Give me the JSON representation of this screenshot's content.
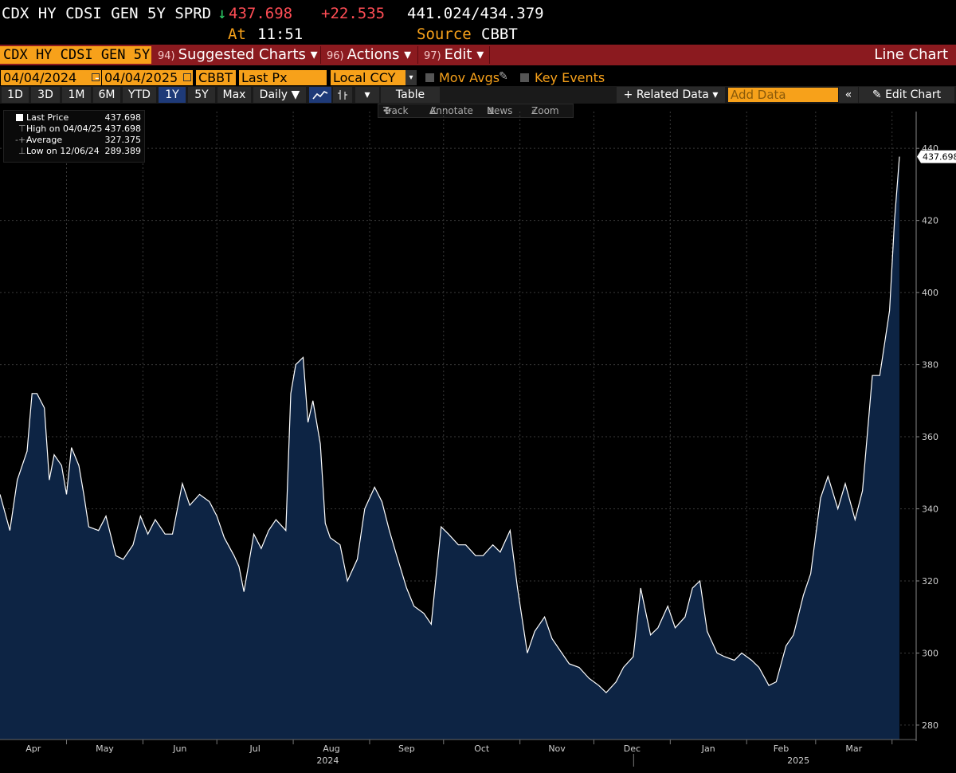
{
  "header": {
    "ticker": "CDX HY CDSI GEN 5Y SPRD",
    "arrow": "↓",
    "last": "437.698",
    "change": "+22.535",
    "bid_ask": "441.024/434.379",
    "time_label": "At",
    "time": "11:51",
    "source_label": "Source",
    "source": "CBBT"
  },
  "menubar": {
    "ticker_field": "CDX HY CDSI GEN 5Y",
    "items": [
      {
        "num": "94)",
        "label": "Suggested Charts ▾"
      },
      {
        "num": "96)",
        "label": "Actions ▾"
      },
      {
        "num": "97)",
        "label": "Edit ▾"
      }
    ],
    "chart_type": "Line Chart"
  },
  "controls": {
    "start_date": "04/04/2024",
    "dash": "-",
    "end_date": "04/04/2025",
    "source": "CBBT",
    "field": "Last Px",
    "currency": "Local CCY",
    "mov_avgs": "Mov Avgs",
    "key_events": "Key Events"
  },
  "toolbar": {
    "periods": [
      "1D",
      "3D",
      "1M",
      "6M",
      "YTD",
      "1Y",
      "5Y",
      "Max"
    ],
    "active_period": "1Y",
    "frequency": "Daily ▼",
    "table": "Table",
    "related": "+ Related Data ▾",
    "add_data_placeholder": "Add Data",
    "collapse": "«",
    "edit_chart": "✎ Edit Chart"
  },
  "tools": {
    "track": "Track",
    "annotate": "Annotate",
    "news": "News",
    "zoom": "Zoom"
  },
  "legend": {
    "last_label": "Last Price",
    "last_value": "437.698",
    "high_label": "High on 04/04/25",
    "high_value": "437.698",
    "avg_label": "Average",
    "avg_value": "327.375",
    "low_label": "Low on 12/06/24",
    "low_value": "289.389"
  },
  "chart_data": {
    "type": "area",
    "series": [
      {
        "name": "Last Price"
      }
    ],
    "last_label": "437.698",
    "ylim": [
      276,
      448
    ],
    "y_ticks": [
      280,
      300,
      320,
      340,
      360,
      380,
      400,
      420,
      440
    ],
    "x_months": [
      "Apr",
      "May",
      "Jun",
      "Jul",
      "Aug",
      "Sep",
      "Oct",
      "Nov",
      "Dec",
      "Jan",
      "Feb",
      "Mar"
    ],
    "x_year_labels": [
      "2024",
      "2025"
    ],
    "grid": true,
    "colors": {
      "line": "#ffffff",
      "fill": "#0d2444",
      "grid": "#3a3a3a",
      "axis_text": "#cfcfcf",
      "last_badge": "#ffffff"
    },
    "points": [
      [
        "2024-04-04",
        344
      ],
      [
        "2024-04-08",
        334
      ],
      [
        "2024-04-11",
        348
      ],
      [
        "2024-04-15",
        356
      ],
      [
        "2024-04-17",
        372
      ],
      [
        "2024-04-19",
        372
      ],
      [
        "2024-04-22",
        368
      ],
      [
        "2024-04-24",
        348
      ],
      [
        "2024-04-26",
        355
      ],
      [
        "2024-04-29",
        352
      ],
      [
        "2024-05-01",
        344
      ],
      [
        "2024-05-03",
        357
      ],
      [
        "2024-05-06",
        352
      ],
      [
        "2024-05-08",
        344
      ],
      [
        "2024-05-10",
        335
      ],
      [
        "2024-05-14",
        334
      ],
      [
        "2024-05-17",
        338
      ],
      [
        "2024-05-21",
        327
      ],
      [
        "2024-05-24",
        326
      ],
      [
        "2024-05-28",
        330
      ],
      [
        "2024-05-31",
        338
      ],
      [
        "2024-06-03",
        333
      ],
      [
        "2024-06-06",
        337
      ],
      [
        "2024-06-10",
        333
      ],
      [
        "2024-06-13",
        333
      ],
      [
        "2024-06-17",
        347
      ],
      [
        "2024-06-20",
        341
      ],
      [
        "2024-06-24",
        344
      ],
      [
        "2024-06-28",
        342
      ],
      [
        "2024-07-01",
        338
      ],
      [
        "2024-07-04",
        332
      ],
      [
        "2024-07-08",
        327
      ],
      [
        "2024-07-10",
        324
      ],
      [
        "2024-07-12",
        317
      ],
      [
        "2024-07-16",
        333
      ],
      [
        "2024-07-19",
        329
      ],
      [
        "2024-07-22",
        334
      ],
      [
        "2024-07-25",
        337
      ],
      [
        "2024-07-29",
        334
      ],
      [
        "2024-07-31",
        372
      ],
      [
        "2024-08-02",
        380
      ],
      [
        "2024-08-05",
        382
      ],
      [
        "2024-08-07",
        364
      ],
      [
        "2024-08-09",
        370
      ],
      [
        "2024-08-12",
        358
      ],
      [
        "2024-08-14",
        336
      ],
      [
        "2024-08-16",
        332
      ],
      [
        "2024-08-20",
        330
      ],
      [
        "2024-08-23",
        320
      ],
      [
        "2024-08-27",
        326
      ],
      [
        "2024-08-30",
        340
      ],
      [
        "2024-09-03",
        346
      ],
      [
        "2024-09-06",
        342
      ],
      [
        "2024-09-09",
        334
      ],
      [
        "2024-09-12",
        327
      ],
      [
        "2024-09-16",
        318
      ],
      [
        "2024-09-19",
        313
      ],
      [
        "2024-09-23",
        311
      ],
      [
        "2024-09-26",
        308
      ],
      [
        "2024-09-30",
        335
      ],
      [
        "2024-10-03",
        333
      ],
      [
        "2024-10-07",
        330
      ],
      [
        "2024-10-10",
        330
      ],
      [
        "2024-10-14",
        327
      ],
      [
        "2024-10-17",
        327
      ],
      [
        "2024-10-21",
        330
      ],
      [
        "2024-10-24",
        328
      ],
      [
        "2024-10-28",
        334
      ],
      [
        "2024-10-31",
        318
      ],
      [
        "2024-11-04",
        300
      ],
      [
        "2024-11-07",
        306
      ],
      [
        "2024-11-11",
        310
      ],
      [
        "2024-11-14",
        304
      ],
      [
        "2024-11-18",
        300
      ],
      [
        "2024-11-21",
        297
      ],
      [
        "2024-11-25",
        296
      ],
      [
        "2024-11-29",
        293
      ],
      [
        "2024-12-03",
        291
      ],
      [
        "2024-12-06",
        289
      ],
      [
        "2024-12-10",
        292
      ],
      [
        "2024-12-13",
        296
      ],
      [
        "2024-12-17",
        299
      ],
      [
        "2024-12-20",
        318
      ],
      [
        "2024-12-24",
        305
      ],
      [
        "2024-12-27",
        307
      ],
      [
        "2024-12-31",
        313
      ],
      [
        "2025-01-03",
        307
      ],
      [
        "2025-01-07",
        310
      ],
      [
        "2025-01-10",
        318
      ],
      [
        "2025-01-13",
        320
      ],
      [
        "2025-01-16",
        306
      ],
      [
        "2025-01-20",
        300
      ],
      [
        "2025-01-23",
        299
      ],
      [
        "2025-01-27",
        298
      ],
      [
        "2025-01-30",
        300
      ],
      [
        "2025-02-03",
        298
      ],
      [
        "2025-02-06",
        296
      ],
      [
        "2025-02-10",
        291
      ],
      [
        "2025-02-13",
        292
      ],
      [
        "2025-02-17",
        302
      ],
      [
        "2025-02-20",
        305
      ],
      [
        "2025-02-24",
        316
      ],
      [
        "2025-02-27",
        322
      ],
      [
        "2025-03-03",
        343
      ],
      [
        "2025-03-06",
        349
      ],
      [
        "2025-03-10",
        340
      ],
      [
        "2025-03-13",
        347
      ],
      [
        "2025-03-17",
        337
      ],
      [
        "2025-03-20",
        345
      ],
      [
        "2025-03-24",
        377
      ],
      [
        "2025-03-27",
        377
      ],
      [
        "2025-03-31",
        395
      ],
      [
        "2025-04-02",
        420
      ],
      [
        "2025-04-04",
        437.698
      ]
    ]
  }
}
